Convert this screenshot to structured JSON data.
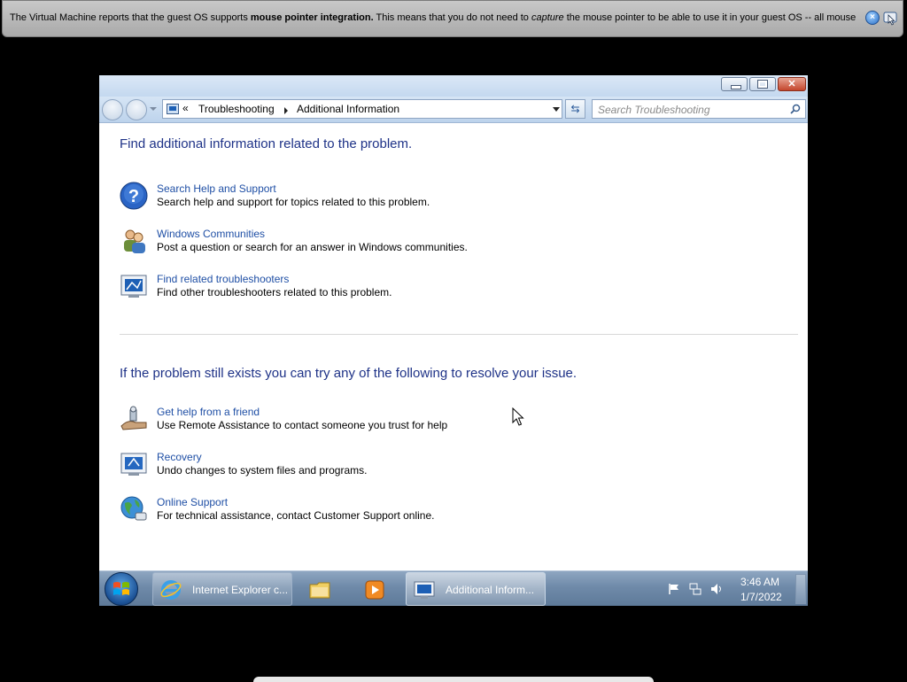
{
  "vm_notification": {
    "text_1": "The Virtual Machine reports that the guest OS supports ",
    "bold": "mouse pointer integration.",
    "text_2": " This means that you do not need to ",
    "italic": "capture",
    "text_3": " the mouse pointer to be able to use it in your guest OS -- all mouse"
  },
  "navigation": {
    "chevron": "«",
    "breadcrumb": [
      "Troubleshooting",
      "Additional Information"
    ],
    "search_placeholder": "Search Troubleshooting"
  },
  "section1": {
    "heading": "Find additional information related to the problem.",
    "items": [
      {
        "icon": "help-icon",
        "link": "Search Help and Support",
        "desc": "Search help and support for topics related to this problem."
      },
      {
        "icon": "users-icon",
        "link": "Windows Communities",
        "desc": "Post a question or search for an answer in Windows communities."
      },
      {
        "icon": "troubleshooter-icon",
        "link": "Find related troubleshooters",
        "desc": "Find other troubleshooters related to this problem."
      }
    ]
  },
  "section2": {
    "heading": "If the problem still exists you can try any of the following to resolve your issue.",
    "items": [
      {
        "icon": "remote-assistance-icon",
        "link": "Get help from a friend",
        "desc": "Use Remote Assistance to contact someone you trust for help"
      },
      {
        "icon": "recovery-icon",
        "link": "Recovery",
        "desc": "Undo changes to system files and programs."
      },
      {
        "icon": "globe-icon",
        "link": "Online Support",
        "desc": "For technical assistance, contact Customer Support online."
      }
    ]
  },
  "taskbar": {
    "ie_label": "Internet Explorer c...",
    "trouble_label": "Additional Inform...",
    "time": "3:46 AM",
    "date": "1/7/2022"
  },
  "colors": {
    "heading": "#1e3287",
    "link": "#1f4fa5",
    "taskbar": "#6f8aa9"
  }
}
